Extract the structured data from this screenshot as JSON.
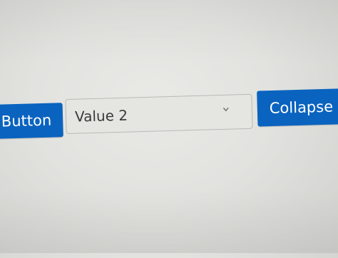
{
  "controls": {
    "left_button_label": "Button",
    "dropdown_value": "Value 2",
    "right_button_label": "Collapse ."
  },
  "colors": {
    "button_blue": "#0a63bf",
    "background": "#e2e2df"
  },
  "icons": {
    "dropdown": "chevron-down-icon"
  }
}
